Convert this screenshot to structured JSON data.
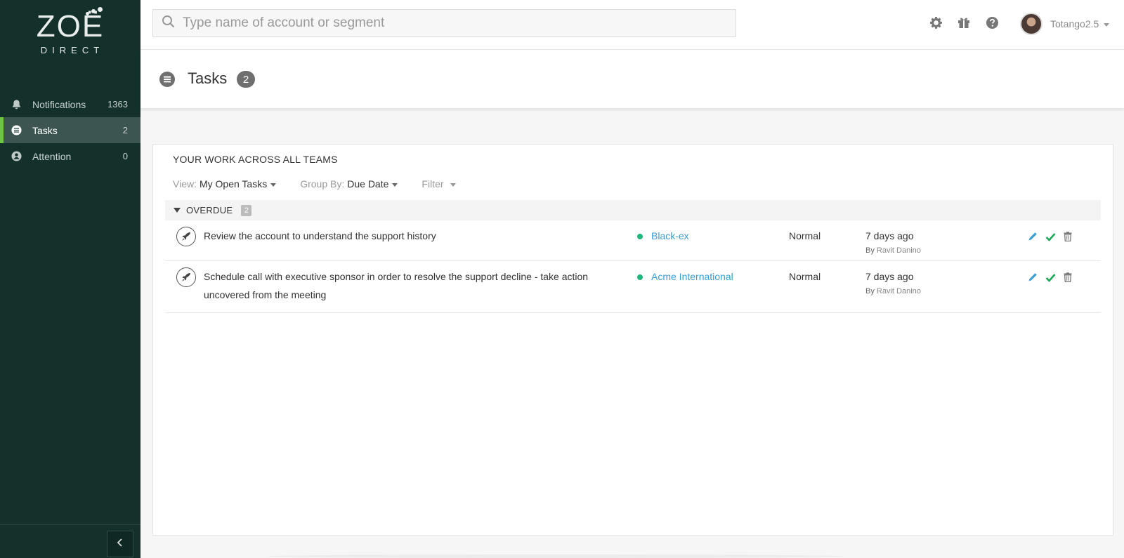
{
  "logo": {
    "main": "ZOË",
    "sub": "DIRECT"
  },
  "sidebar": {
    "items": [
      {
        "label": "Notifications",
        "count": "1363",
        "icon": "bell-icon"
      },
      {
        "label": "Tasks",
        "count": "2",
        "icon": "list-icon"
      },
      {
        "label": "Attention",
        "count": "0",
        "icon": "person-alert-icon"
      }
    ]
  },
  "search": {
    "placeholder": "Type name of account or segment"
  },
  "header": {
    "user_name": "Totango2.5"
  },
  "page": {
    "title": "Tasks",
    "count": "2"
  },
  "panel": {
    "title": "YOUR WORK ACROSS ALL TEAMS",
    "view_label": "View:",
    "view_value": "My Open Tasks",
    "group_label": "Group By:",
    "group_value": "Due Date",
    "filter_label": "Filter"
  },
  "group": {
    "label": "OVERDUE",
    "count": "2"
  },
  "tasks": [
    {
      "title": "Review the account to understand the support history",
      "account": "Black-ex",
      "priority": "Normal",
      "due": "7 days ago",
      "by_prefix": "By",
      "by": "Ravit Danino"
    },
    {
      "title": "Schedule call with executive sponsor in order to resolve the support decline - take action uncovered from the meeting",
      "account": "Acme International",
      "priority": "Normal",
      "due": "7 days ago",
      "by_prefix": "By",
      "by": "Ravit Danino"
    }
  ],
  "colors": {
    "sidebar_bg": "#13302b",
    "active_accent": "#6cc644",
    "link": "#3a9fd1",
    "status_green": "#1fb87d",
    "complete_green": "#1fa85a"
  }
}
